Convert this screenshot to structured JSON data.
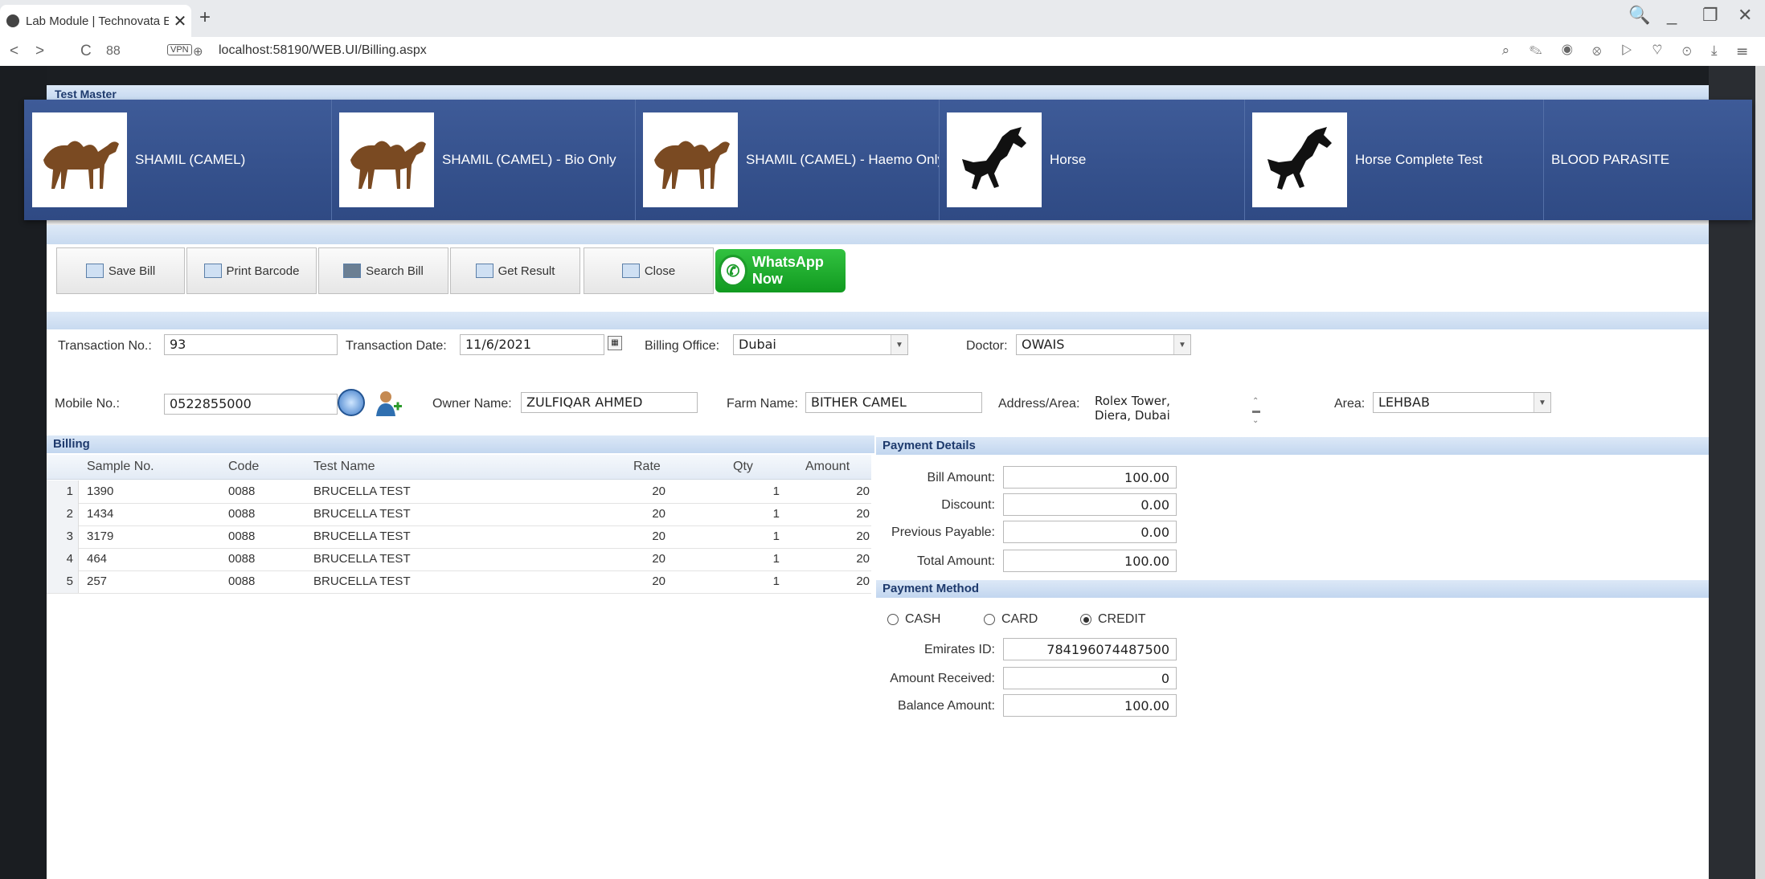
{
  "browser": {
    "tab_title": "Lab Module | Technovata E",
    "tab_close": "✕",
    "new_tab": "+",
    "back": "<",
    "forward": ">",
    "reload": "C",
    "speed_dial": "88",
    "vpn": "VPN",
    "url": "localhost:58190/WEB.UI/Billing.aspx",
    "win_search": "🔍",
    "win_minimize": "_",
    "win_restore": "❐",
    "win_close": "✕"
  },
  "master": {
    "title": "Test Master",
    "items": [
      {
        "label": "SHAMIL (CAMEL)",
        "icon": "camel"
      },
      {
        "label": "SHAMIL (CAMEL) - Bio Only",
        "icon": "camel"
      },
      {
        "label": "SHAMIL (CAMEL) - Haemo Only",
        "icon": "camel"
      },
      {
        "label": "Horse",
        "icon": "horse"
      },
      {
        "label": "Horse Complete Test",
        "icon": "horse"
      },
      {
        "label": "BLOOD PARASITE",
        "icon": ""
      }
    ]
  },
  "toolbar": {
    "save": "Save Bill",
    "print": "Print Barcode",
    "search": "Search Bill",
    "result": "Get Result",
    "close": "Close",
    "whatsapp": "WhatsApp Now"
  },
  "form": {
    "transaction_no_label": "Transaction No.:",
    "transaction_no": "93",
    "transaction_date_label": "Transaction Date:",
    "transaction_date": "11/6/2021",
    "billing_office_label": "Billing Office:",
    "billing_office": "Dubai",
    "doctor_label": "Doctor:",
    "doctor": "OWAIS",
    "mobile_label": "Mobile No.:",
    "mobile": "0522855000",
    "owner_label": "Owner Name:",
    "owner": "ZULFIQAR AHMED",
    "farm_label": "Farm Name:",
    "farm": "BITHER CAMEL",
    "address_label": "Address/Area:",
    "address_line1": "Rolex Tower,",
    "address_line2": "Diera, Dubai",
    "area_label": "Area:",
    "area": "LEHBAB"
  },
  "billing": {
    "title": "Billing",
    "columns": {
      "sample": "Sample No.",
      "code": "Code",
      "test": "Test Name",
      "rate": "Rate",
      "qty": "Qty",
      "amount": "Amount"
    },
    "rows": [
      {
        "n": "1",
        "sample": "1390",
        "code": "0088",
        "test": "BRUCELLA TEST",
        "rate": "20",
        "qty": "1",
        "amount": "20"
      },
      {
        "n": "2",
        "sample": "1434",
        "code": "0088",
        "test": "BRUCELLA TEST",
        "rate": "20",
        "qty": "1",
        "amount": "20"
      },
      {
        "n": "3",
        "sample": "3179",
        "code": "0088",
        "test": "BRUCELLA TEST",
        "rate": "20",
        "qty": "1",
        "amount": "20"
      },
      {
        "n": "4",
        "sample": "464",
        "code": "0088",
        "test": "BRUCELLA TEST",
        "rate": "20",
        "qty": "1",
        "amount": "20"
      },
      {
        "n": "5",
        "sample": "257",
        "code": "0088",
        "test": "BRUCELLA TEST",
        "rate": "20",
        "qty": "1",
        "amount": "20"
      }
    ]
  },
  "payment": {
    "title": "Payment Details",
    "bill_amount_label": "Bill Amount:",
    "bill_amount": "100.00",
    "discount_label": "Discount:",
    "discount": "0.00",
    "previous_label": "Previous Payable:",
    "previous": "0.00",
    "total_label": "Total Amount:",
    "total": "100.00",
    "method_title": "Payment Method",
    "cash": "CASH",
    "card": "CARD",
    "credit": "CREDIT",
    "selected": "CREDIT",
    "emirates_label": "Emirates ID:",
    "emirates": "784196074487500",
    "received_label": "Amount Received:",
    "received": "0",
    "balance_label": "Balance Amount:",
    "balance": "100.00"
  }
}
